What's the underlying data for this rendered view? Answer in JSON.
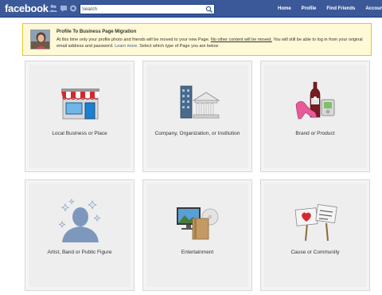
{
  "header": {
    "logo": "facebook",
    "search_placeholder": "Search",
    "nav": [
      "Home",
      "Profile",
      "Find Friends",
      "Account"
    ]
  },
  "notice": {
    "title": "Profile To Business Page Migration",
    "text_1": "At this time only your profile photo and friends will be moved to your new Page.",
    "text_underlined": "No other content will be moved.",
    "text_2": "You will still be able to log in from your original email address and password.",
    "learn_more": "Learn more.",
    "text_3": "Select which type of Page you are below"
  },
  "categories": [
    {
      "label": "Local Business or Place",
      "icon": "storefront-icon"
    },
    {
      "label": "Company, Organization, or Institution",
      "icon": "buildings-icon"
    },
    {
      "label": "Brand or Product",
      "icon": "products-icon"
    },
    {
      "label": "Artist, Band or Public Figure",
      "icon": "person-silhouette-icon"
    },
    {
      "label": "Entertainment",
      "icon": "media-icon"
    },
    {
      "label": "Cause or Community",
      "icon": "signs-icon"
    }
  ],
  "colors": {
    "header_blue": "#3b5998",
    "notice_bg": "#fff9d7",
    "notice_border": "#e2c822",
    "tile_bg": "#eeeeee"
  }
}
